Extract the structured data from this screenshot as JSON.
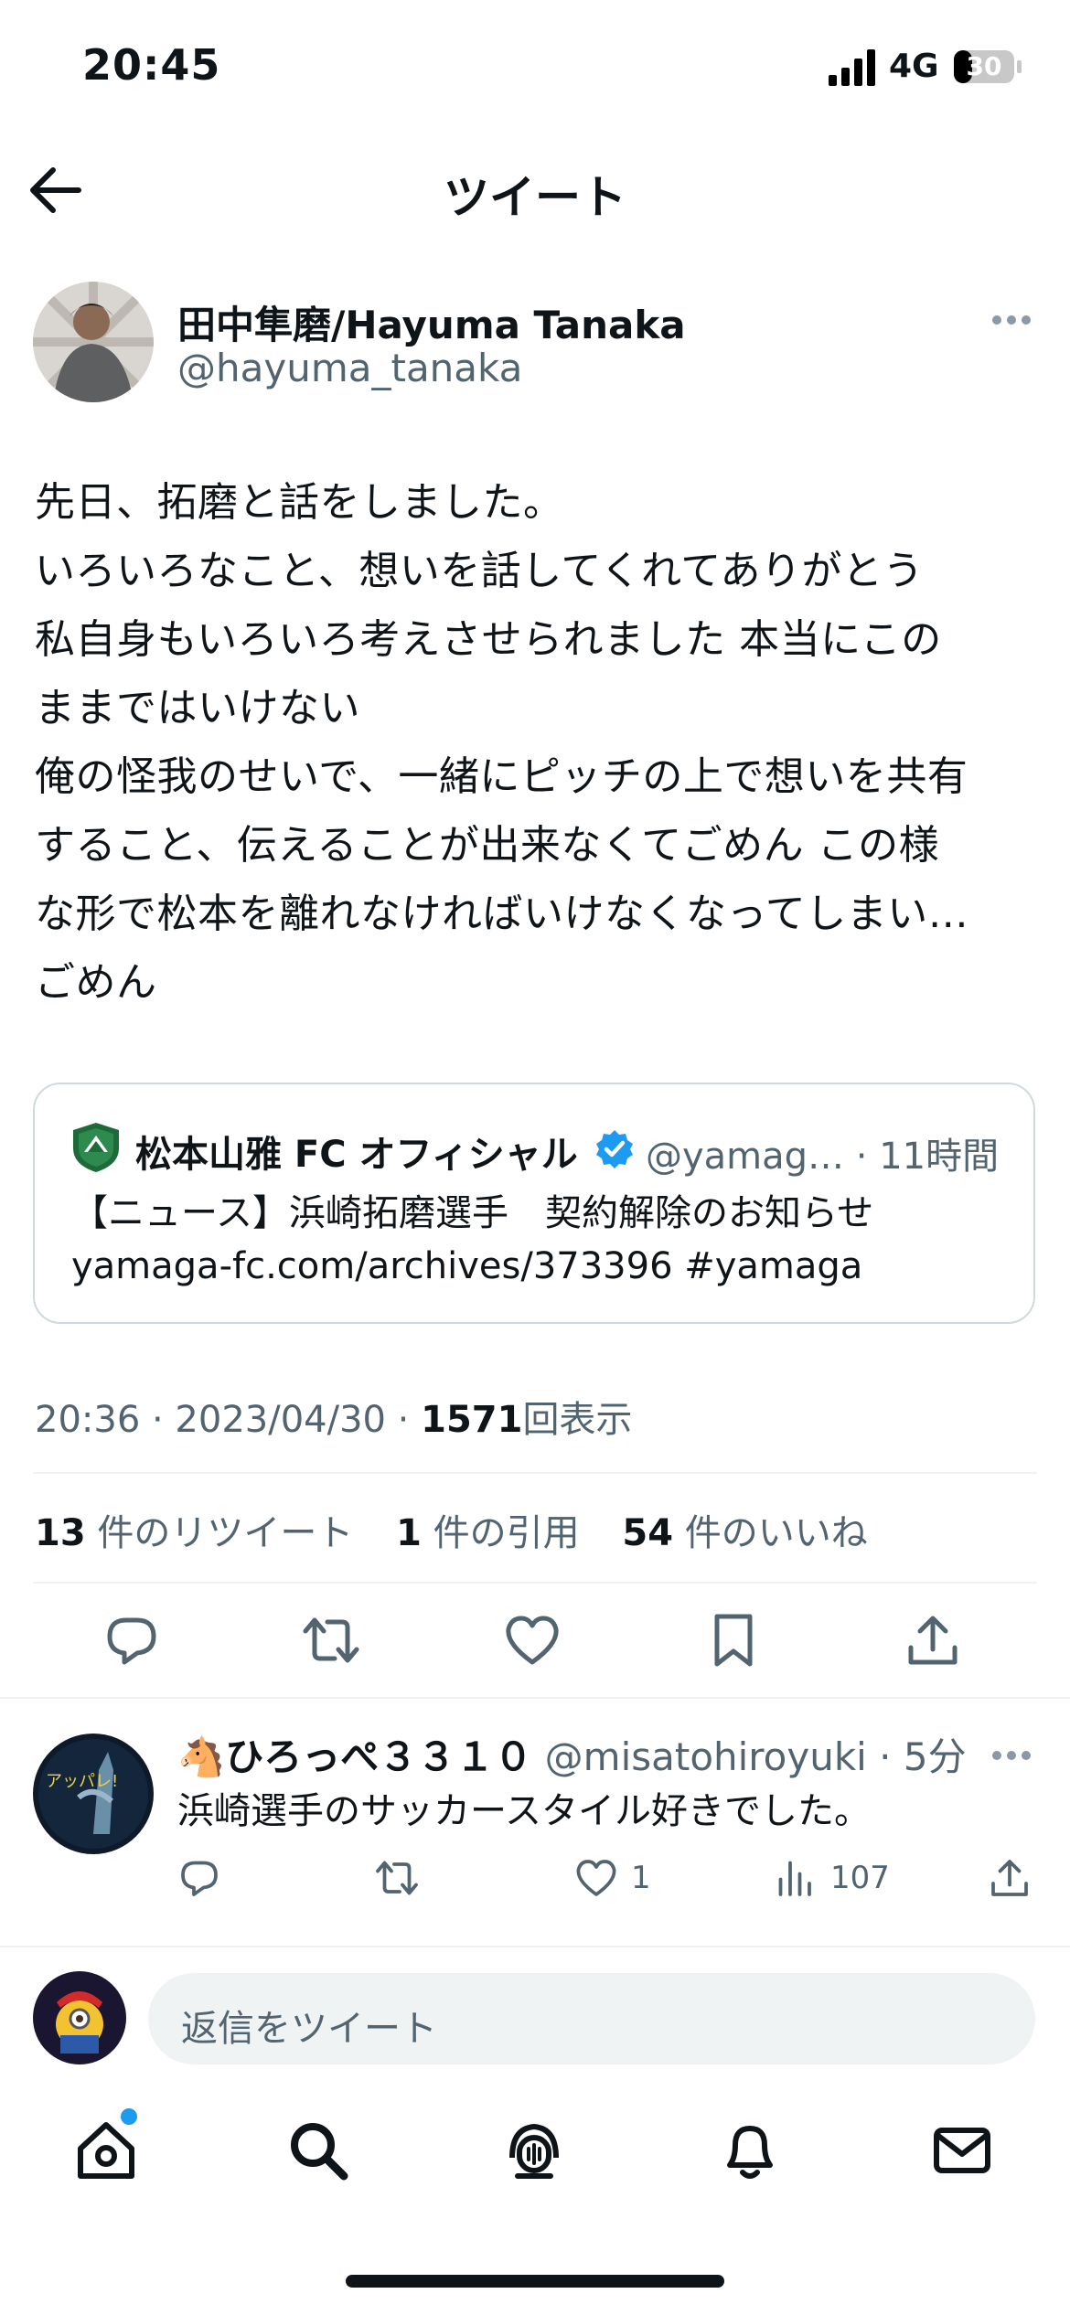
{
  "status_bar": {
    "time": "20:45",
    "network": "4G",
    "battery": "30"
  },
  "header": {
    "title": "ツイート"
  },
  "tweet": {
    "author_name": "田中隼磨/Hayuma Tanaka",
    "author_handle": "@hayuma_tanaka",
    "text": "先日、拓磨と話をしました。\nいろいろなこと、想いを話してくれてありがとう\n私自身もいろいろ考えさせられました 本当にこの\nままではいけない\n俺の怪我のせいで、一緒にピッチの上で想いを共有\nすること、伝えることが出来なくてごめん この様\nな形で松本を離れなければいけなくなってしまい…\nごめん",
    "quote": {
      "name": "松本山雅 FC オフィシャル",
      "handle_time": "@yamag… · 11時間",
      "text": "【ニュース】浜崎拓磨選手　契約解除のお知らせ\nyamaga-fc.com/archives/373396 #yamaga"
    },
    "meta": {
      "time_date": "20:36 · 2023/04/30 · ",
      "views": "1571",
      "views_label": "回表示"
    },
    "stats": {
      "retweets": "13",
      "retweets_label": "件のリツイート",
      "quotes": "1",
      "quotes_label": "件の引用",
      "likes": "54",
      "likes_label": "件のいいね"
    }
  },
  "reply": {
    "name": "🐴ひろっぺ３３１０",
    "handle_time": "@misatohiroyuki · 5分",
    "text": "浜崎選手のサッカースタイル好きでした。",
    "likes": "1",
    "views": "107"
  },
  "compose": {
    "placeholder": "返信をツイート"
  },
  "colors": {
    "accent": "#1d9bf0",
    "text": "#0f1419",
    "secondary": "#536471",
    "divider": "#eff3f4"
  },
  "icons": {
    "back": "arrow-left-icon",
    "more": "more-dots-icon",
    "reply": "reply-icon",
    "retweet": "retweet-icon",
    "like": "heart-icon",
    "bookmark": "bookmark-icon",
    "share": "share-icon",
    "views": "views-icon",
    "tabs": [
      "home-icon",
      "search-icon",
      "spaces-icon",
      "bell-icon",
      "mail-icon"
    ]
  }
}
